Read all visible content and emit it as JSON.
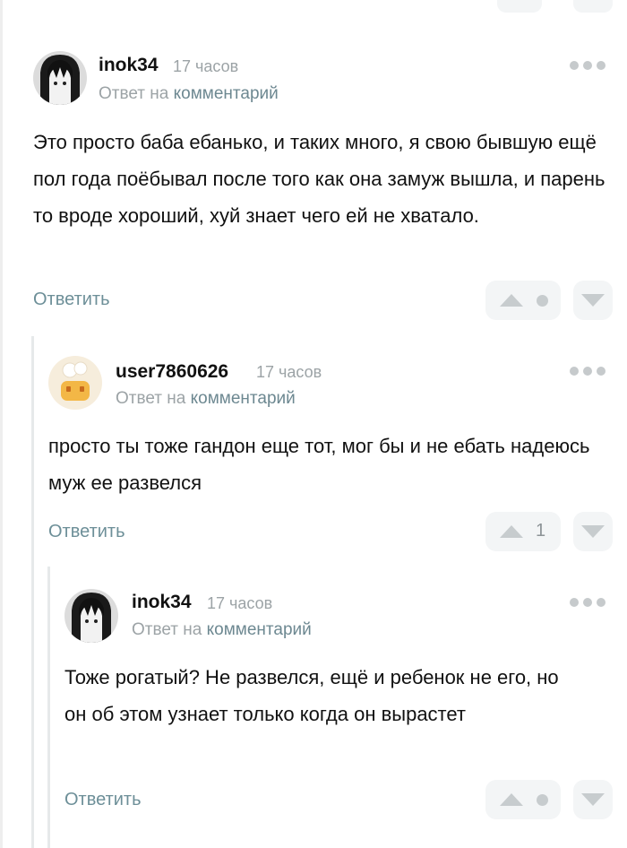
{
  "comments": [
    {
      "author": "inok34",
      "time": "17 часов",
      "reply_prefix": "Ответ на",
      "reply_link": "комментарий",
      "text": "Это просто баба ебанько, и таких много, я свою бывшую ещё пол года поёбывал после того как она замуж вышла, и парень то вроде хороший, хуй знает чего ей не хватало.",
      "answer_label": "Ответить",
      "rating": null
    },
    {
      "author": "user7860626",
      "time": "17 часов",
      "reply_prefix": "Ответ на",
      "reply_link": "комментарий",
      "text": "просто ты тоже гандон еще тот, мог бы и не ебать надеюсь муж ее развелся",
      "answer_label": "Ответить",
      "rating": "1"
    },
    {
      "author": "inok34",
      "time": "17 часов",
      "reply_prefix": "Ответ на",
      "reply_link": "комментарий",
      "text": "Тоже рогатый? Не развелся, ещё и ребенок не его, но он об этом узнает только когда он вырастет",
      "answer_label": "Ответить",
      "rating": null
    }
  ],
  "icons": {
    "more": "more-dots-icon",
    "upvote": "upvote-arrow-icon",
    "downvote": "downvote-arrow-icon",
    "neutral": "rating-dot-icon"
  },
  "colors": {
    "link": "#6d8891",
    "answer": "#6d8f98",
    "muted": "#9ca3a6",
    "vote_bg": "#f3f5f6"
  }
}
